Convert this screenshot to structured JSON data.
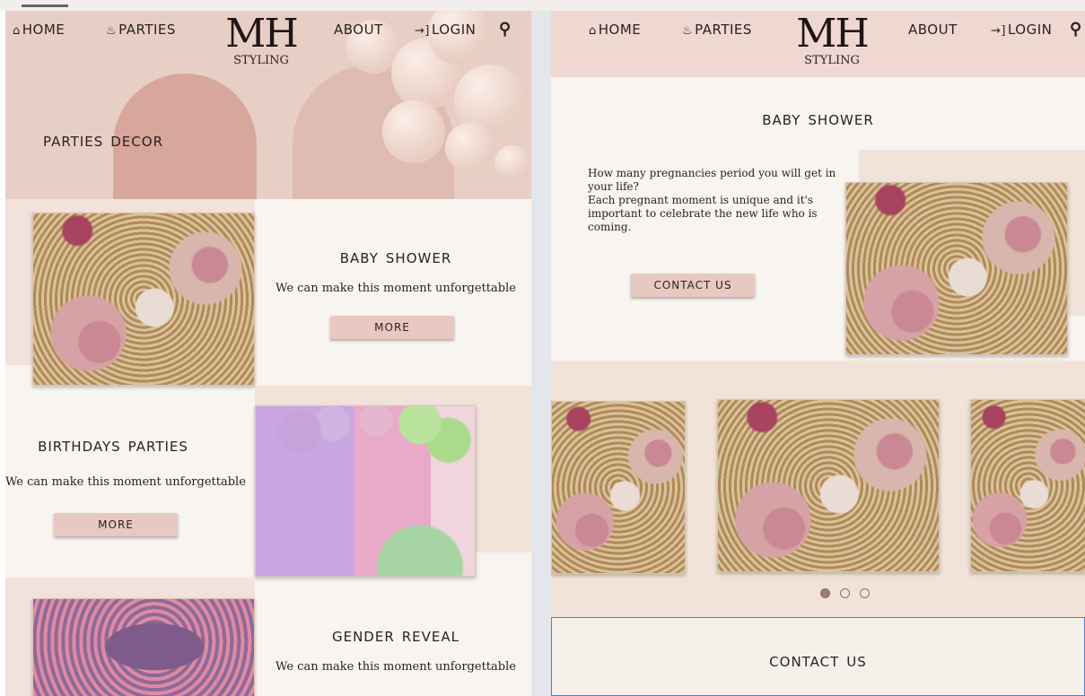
{
  "left": {
    "nav": {
      "home": "HOME",
      "parties": "PARTIES",
      "about": "ABOUT",
      "login": "LOGIN",
      "logo_mark": "MH",
      "logo_sub": "STYLING"
    },
    "hero_title": "PARTIES DECOR",
    "sections": [
      {
        "title": "BABY SHOWER",
        "desc": "We can make this moment unforgettable",
        "button": "MORE"
      },
      {
        "title": "BIRTHDAYS PARTIES",
        "desc": "We can make this moment unforgettable",
        "button": "MORE"
      },
      {
        "title": "GENDER REVEAL",
        "desc": "We can make this moment unforgettable"
      }
    ]
  },
  "right": {
    "nav": {
      "home": "HOME",
      "parties": "PARTIES",
      "about": "ABOUT",
      "login": "LOGIN",
      "logo_mark": "MH",
      "logo_sub": "STYLING"
    },
    "title": "BABY SHOWER",
    "paragraph_1": "How many pregnancies period you will get in your life?",
    "paragraph_2": "Each pregnant moment is unique and it's important to celebrate the new life who is coming.",
    "contact_button": "CONTACT US",
    "carousel": {
      "active_index": 0,
      "dot_count": 3
    },
    "contact_title": "CONTACT US"
  },
  "icons": {
    "home": "house-icon",
    "parties": "cake-icon",
    "login": "login-arrow-icon",
    "search": "search-icon"
  },
  "colors": {
    "accent_button": "#e8c9c1",
    "page_bg": "#f8f4ef",
    "header_pink": "#efd7d2",
    "focus_border": "#4a86c8"
  }
}
